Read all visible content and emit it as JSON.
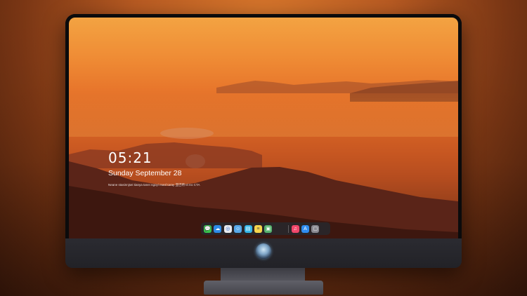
{
  "lock_screen": {
    "time": "05:21",
    "date": "Sunday September  28",
    "status": "Neane stasinnjsei tianya tanei ngoyi rnanl taray 亚巴特 tri tro CTA"
  },
  "dock": {
    "items": [
      {
        "name": "messages-app",
        "icon": "messages-icon",
        "color": "#3ac24d",
        "glyph": "💬"
      },
      {
        "name": "weather-app",
        "icon": "weather-icon",
        "color": "#2d8ae6",
        "glyph": "☁"
      },
      {
        "name": "safari-app",
        "icon": "compass-icon",
        "color": "#e9e9ec",
        "glyph": "◎"
      },
      {
        "name": "finder-app",
        "icon": "finder-icon",
        "color": "#58a8e8",
        "glyph": "☺"
      },
      {
        "name": "clips-app",
        "icon": "clapperboard-icon",
        "color": "#36b6e8",
        "glyph": "▤"
      },
      {
        "name": "notes-app",
        "icon": "notes-icon",
        "color": "#f6d44c",
        "glyph": "≡"
      },
      {
        "name": "preview-app",
        "icon": "photos-icon",
        "color": "#58b36f",
        "glyph": "▣"
      },
      {
        "name": "music-app",
        "icon": "music-icon",
        "color": "#f0476a",
        "glyph": "♫"
      },
      {
        "name": "app-store",
        "icon": "app-store-icon",
        "color": "#2f8cf0",
        "glyph": "A"
      },
      {
        "name": "screenshot-app",
        "icon": "camera-icon",
        "color": "#8a8a92",
        "glyph": "▢"
      }
    ]
  }
}
